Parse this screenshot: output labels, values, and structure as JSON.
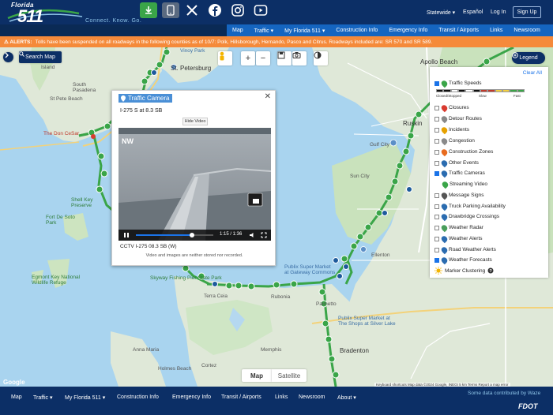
{
  "header": {
    "logo_state": "Florida",
    "logo_number": "511",
    "tagline": "Connect. Know. Go.",
    "state_select": "Statewide ▾",
    "language": "Español",
    "login": "Log In",
    "signup": "Sign Up"
  },
  "social": [
    {
      "icon": "app-download-icon",
      "color": "#3aa548"
    },
    {
      "icon": "phone-app-icon",
      "color": "#5a6a80"
    },
    {
      "icon": "x-twitter-icon",
      "color": "#0c2f66"
    },
    {
      "icon": "facebook-icon",
      "color": "#0c2f66"
    },
    {
      "icon": "instagram-icon",
      "color": "#0c2f66"
    },
    {
      "icon": "youtube-icon",
      "color": "#0c2f66"
    }
  ],
  "nav": [
    "Map",
    "Traffic ▾",
    "My Florida 511 ▾",
    "Construction Info",
    "Emergency Info",
    "Transit / Airports",
    "Links",
    "Newsroom"
  ],
  "alert": {
    "label": "⚠ ALERTS:",
    "text": "Tolls have been suspended on all roadways in the following counties as of 10/7: Polk, Hillsborough, Hernando, Pasco and Citrus. Roadways included are: SR 570 and SR 589."
  },
  "map_controls": {
    "search_label": "Search Map",
    "legend_label": "Legend",
    "zoom_in": "+",
    "zoom_out": "−",
    "map_tab": "Map",
    "satellite_tab": "Satellite"
  },
  "map_labels": {
    "st_petersburg": "St. Petersburg",
    "st_pete_beach": "St Pete Beach",
    "south_pasadena": "South\nPasadena",
    "island": "Island",
    "vinoy_park": "Vinoy Park",
    "don_cesar": "The Don CeSar",
    "shell_key": "Shell Key\nPreserve",
    "fort_de_soto": "Fort De Soto\nPark",
    "egmont_key": "Egmont Key National\nWildlife Refuge",
    "apollo_beach": "Apollo Beach",
    "ruskin": "Ruskin",
    "sun_city": "Sun City",
    "gulf_city": "Gulf City",
    "ellenton": "Ellenton",
    "terra_ceia": "Terra Ceia",
    "rubonia": "Rubonia",
    "memphis": "Memphis",
    "bradenton": "Bradenton",
    "palmetto": "Palmetto",
    "anna_maria": "Anna Maria",
    "holmes_beach": "Holmes Beach",
    "cortez": "Cortez",
    "skyway_fishing": "Skyway Fishing Pier State Park",
    "publix_1": "Publix Super Market\nat Gateway Commons",
    "publix_2": "Publix Super Market at\nThe Shops at Silver Lake",
    "google": "Google",
    "attribution": "Keyboard shortcuts   Map data ©2024 Google, INEGI   5 km   Terms   Report a map error"
  },
  "camera_popup": {
    "title": "Traffic Camera",
    "name": "I-275 S at 8.3 SB",
    "hide_video": "Hide Video",
    "overlay": "NW",
    "time": "1:15 / 1:36",
    "caption": "CCTV I-275 08.3 SB (W)",
    "note": "Video and images are neither stored nor recorded.",
    "progress": 0.72
  },
  "legend": {
    "clear_all": "Clear All",
    "items": [
      {
        "label": "Traffic Speeds",
        "checked": true,
        "color": "#3aa548"
      },
      {
        "label": "Closures",
        "checked": false,
        "color": "#d93b30"
      },
      {
        "label": "Detour Routes",
        "checked": false,
        "color": "#888888"
      },
      {
        "label": "Incidents",
        "checked": false,
        "color": "#e6a100"
      },
      {
        "label": "Congestion",
        "checked": false,
        "color": "#8a8a8a"
      },
      {
        "label": "Construction Zones",
        "checked": false,
        "color": "#e86b1f"
      },
      {
        "label": "Other Events",
        "checked": false,
        "color": "#2b6cb0"
      },
      {
        "label": "Traffic Cameras",
        "checked": true,
        "color": "#2b6cb0"
      },
      {
        "label": "Streaming Video",
        "checked": false,
        "color": "#3aa548"
      },
      {
        "label": "Message Signs",
        "checked": false,
        "color": "#555555"
      },
      {
        "label": "Truck Parking Availability",
        "checked": false,
        "color": "#2b6cb0"
      },
      {
        "label": "Drawbridge Crossings",
        "checked": false,
        "color": "#2b6cb0"
      },
      {
        "label": "Weather Radar",
        "checked": false,
        "color": "#4a9e5c"
      },
      {
        "label": "Weather Alerts",
        "checked": false,
        "color": "#2b6cb0"
      },
      {
        "label": "Road Weather Alerts",
        "checked": false,
        "color": "#2b6cb0"
      },
      {
        "label": "Weather Forecasts",
        "checked": true,
        "color": "#2b6cb0"
      }
    ],
    "speed_labels": [
      "Closed/Stopped",
      "Slow",
      "Fast"
    ],
    "marker_clustering": "Marker Clustering"
  },
  "bottom_nav": [
    "Map",
    "Traffic ▾",
    "My Florida 511 ▾",
    "Construction Info",
    "Emergency Info",
    "Transit / Airports",
    "Links",
    "Newsroom",
    "About ▾"
  ],
  "footer_note": "Some data contributed by Waze",
  "fdot": "FDOT"
}
